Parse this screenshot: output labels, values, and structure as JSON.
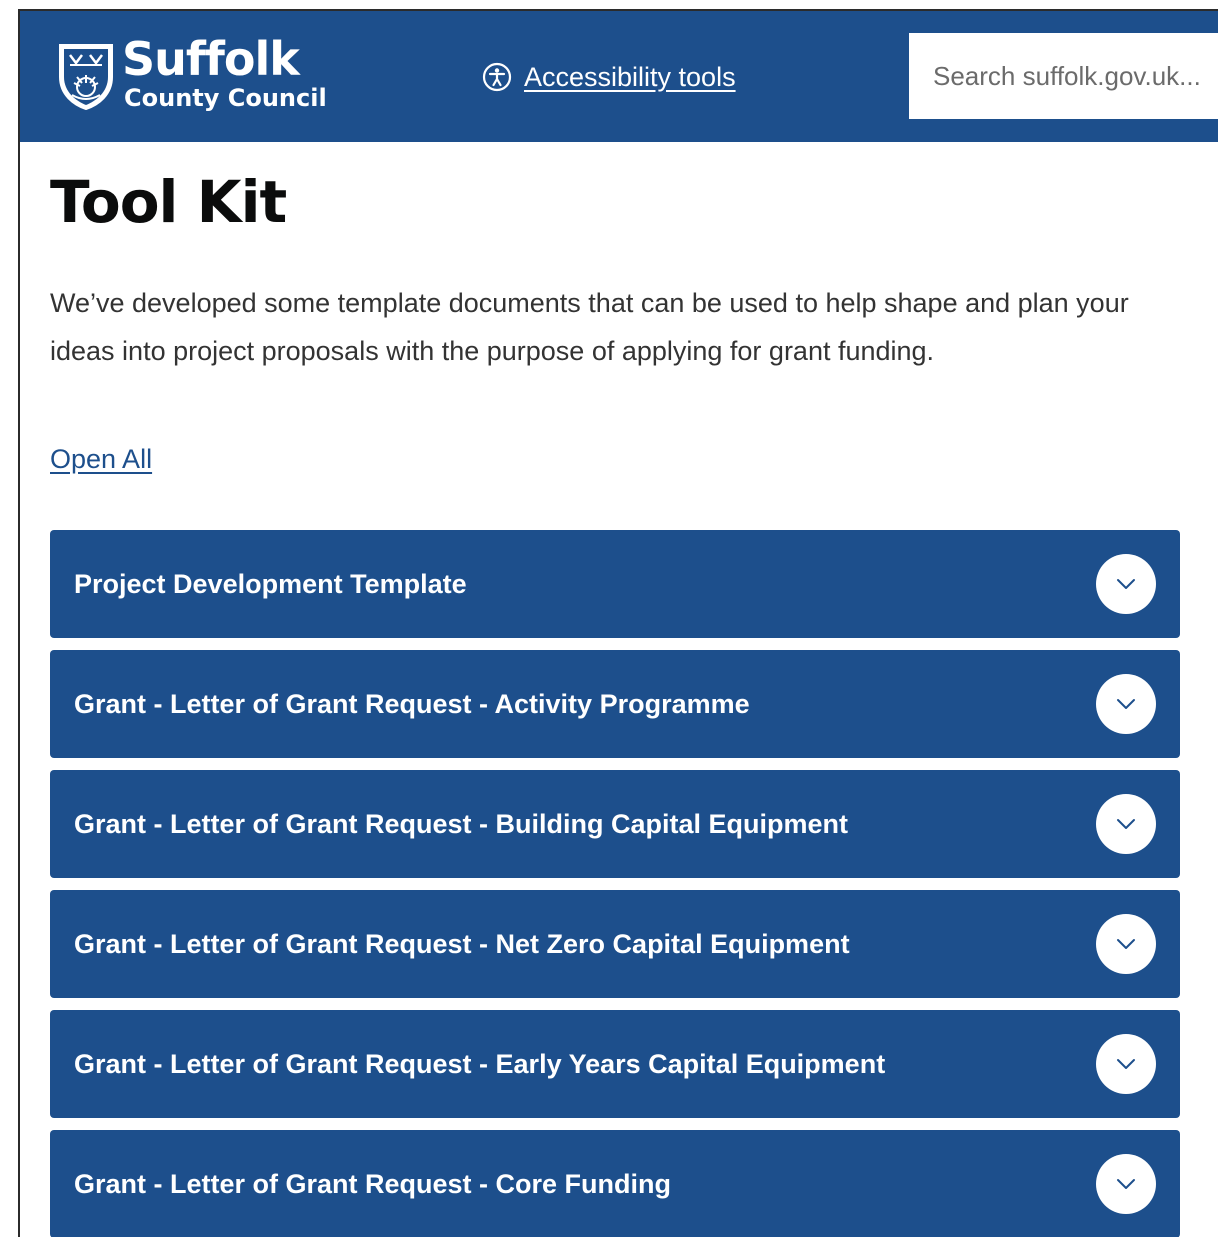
{
  "header": {
    "logo": {
      "name": "Suffolk",
      "subtitle": "County Council",
      "icon": "suffolk-crest-icon"
    },
    "accessibility": {
      "label": "Accessibility tools",
      "icon": "accessibility-icon"
    },
    "search": {
      "placeholder": "Search suffolk.gov.uk..."
    }
  },
  "main": {
    "title": "Tool Kit",
    "intro": "We’ve developed some template documents that can be used to help shape and plan your ideas into project proposals with the purpose of applying for grant funding.",
    "open_all_label": "Open All",
    "accordion": [
      {
        "title": "Project Development Template",
        "icon": "chevron-down-icon"
      },
      {
        "title": "Grant - Letter of Grant Request - Activity Programme",
        "icon": "chevron-down-icon"
      },
      {
        "title": "Grant - Letter of Grant Request - Building Capital Equipment",
        "icon": "chevron-down-icon"
      },
      {
        "title": "Grant - Letter of Grant Request - Net Zero Capital Equipment",
        "icon": "chevron-down-icon"
      },
      {
        "title": "Grant - Letter of Grant Request - Early Years Capital Equipment",
        "icon": "chevron-down-icon"
      },
      {
        "title": "Grant - Letter of Grant Request - Core Funding",
        "icon": "chevron-down-icon"
      }
    ]
  },
  "colors": {
    "brand_blue": "#1d4f8c",
    "text_dark": "#0b0c0c",
    "text_body": "#333333",
    "white": "#ffffff"
  }
}
